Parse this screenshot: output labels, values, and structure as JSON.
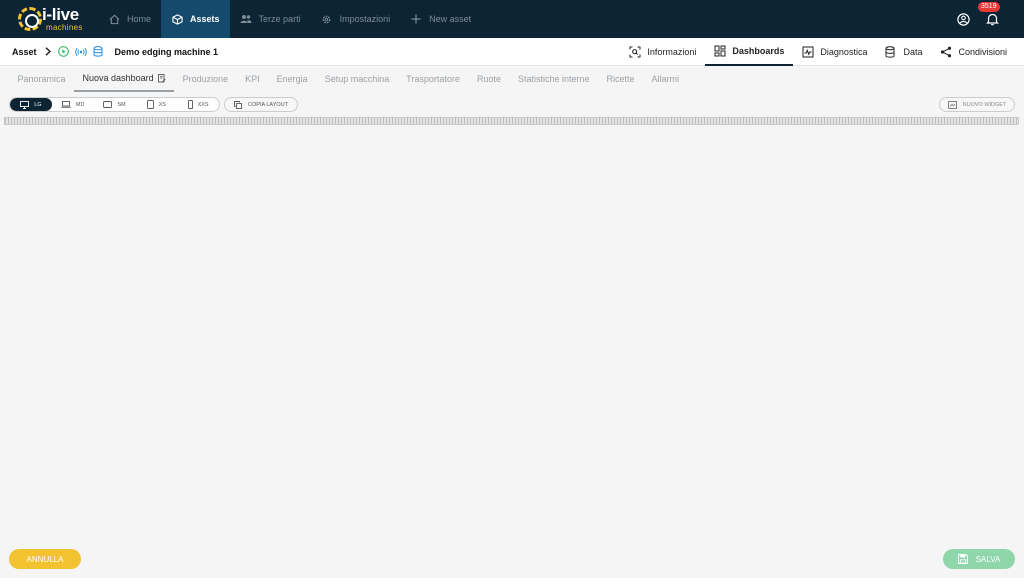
{
  "brand": {
    "name": "i-live",
    "sub": "machines"
  },
  "nav": [
    {
      "label": "Home",
      "icon": "home-icon"
    },
    {
      "label": "Assets",
      "icon": "cube-icon",
      "active": true
    },
    {
      "label": "Terze parti",
      "icon": "people-icon"
    },
    {
      "label": "Impostazioni",
      "icon": "gear-icon"
    },
    {
      "label": "New asset",
      "icon": "plus-icon"
    }
  ],
  "notifications": {
    "count": "3519"
  },
  "breadcrumb": {
    "root": "Asset",
    "title": "Demo edging machine 1"
  },
  "right_tabs": [
    {
      "label": "Informazioni",
      "icon": "search-scan-icon"
    },
    {
      "label": "Dashboards",
      "icon": "dashboard-icon",
      "active": true
    },
    {
      "label": "Diagnostica",
      "icon": "diagnostics-icon"
    },
    {
      "label": "Data",
      "icon": "database-icon"
    },
    {
      "label": "Condivisioni",
      "icon": "share-icon"
    }
  ],
  "sub_tabs": [
    {
      "label": "Panoramica"
    },
    {
      "label": "Nuova dashboard",
      "active": true
    },
    {
      "label": "Produzione"
    },
    {
      "label": "KPI"
    },
    {
      "label": "Energia"
    },
    {
      "label": "Setup macchina"
    },
    {
      "label": "Trasportatore"
    },
    {
      "label": "Ruote"
    },
    {
      "label": "Statistiche interne"
    },
    {
      "label": "Ricette"
    },
    {
      "label": "Allarmi"
    }
  ],
  "sizes": [
    {
      "label": "LG",
      "active": true
    },
    {
      "label": "MD"
    },
    {
      "label": "SM"
    },
    {
      "label": "XS"
    },
    {
      "label": "XXS"
    }
  ],
  "toolbar": {
    "copy_layout": "COPIA LAYOUT",
    "new_widget": "NUOVO WIDGET"
  },
  "footer": {
    "cancel": "ANNULLA",
    "save": "SALVA"
  },
  "colors": {
    "navbar": "#0c2433",
    "active_nav": "#144a6b",
    "accent": "#f2c230",
    "save": "#8fd6aa",
    "badge": "#e53935"
  }
}
